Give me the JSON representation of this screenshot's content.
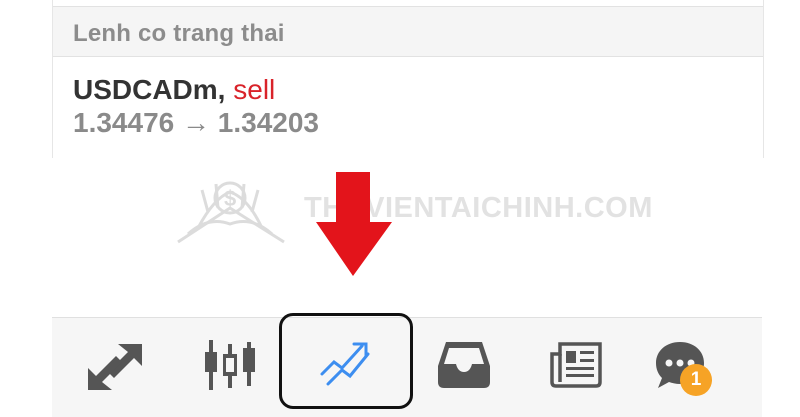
{
  "section": {
    "title": "Lenh co trang thai"
  },
  "order": {
    "symbol": "USDCADm,",
    "type": "sell",
    "open_price": "1.34476",
    "arrow": "→",
    "close_price": "1.34203"
  },
  "watermark": {
    "text": "THUVIENTAICHINH.COM"
  },
  "bottom_nav": {
    "tabs": [
      {
        "icon": "quotes-icon"
      },
      {
        "icon": "candlestick-chart-icon"
      },
      {
        "icon": "trade-icon",
        "active": true
      },
      {
        "icon": "history-inbox-icon"
      },
      {
        "icon": "news-icon"
      },
      {
        "icon": "chat-icon",
        "badge": "1"
      }
    ]
  },
  "colors": {
    "sell": "#d9232a",
    "active_icon": "#3d8ef0",
    "inactive_icon": "#555555",
    "badge": "#f6a326",
    "annotation_arrow": "#e3141b"
  }
}
